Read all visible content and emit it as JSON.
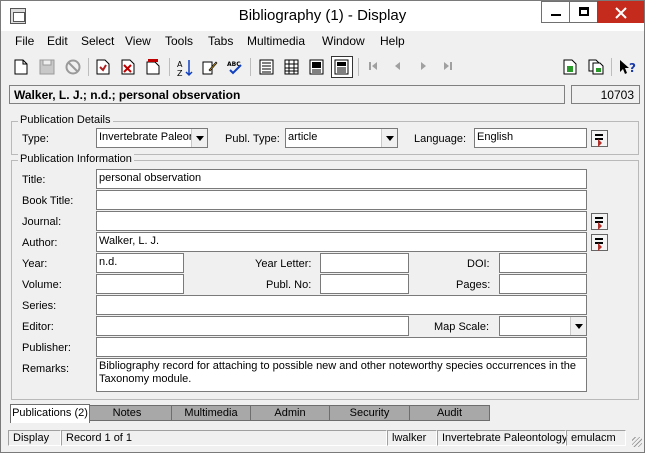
{
  "window": {
    "title": "Bibliography (1) - Display"
  },
  "menu": [
    "File",
    "Edit",
    "Select",
    "View",
    "Tools",
    "Tabs",
    "Multimedia",
    "Window",
    "Help"
  ],
  "toolbar": {
    "icons": [
      "new-record-icon",
      "save-icon",
      "cancel-icon",
      "open-icon",
      "delete-icon",
      "copy-icon",
      "sort-icon",
      "edit-icon",
      "spellcheck-icon",
      "page-view-icon",
      "list-view-icon",
      "report-view-icon",
      "form-view-icon",
      "first-record-icon",
      "prev-record-icon",
      "next-record-icon",
      "last-record-icon",
      "new-copy-icon",
      "duplicate-icon",
      "help-icon"
    ]
  },
  "header": {
    "summary": "Walker, L. J.; n.d.; personal observation",
    "record_id": "10703"
  },
  "publication_details": {
    "legend": "Publication Details",
    "type_label": "Type:",
    "type_value": "Invertebrate Paleon",
    "publ_type_label": "Publ. Type:",
    "publ_type_value": "article",
    "language_label": "Language:",
    "language_value": "English"
  },
  "publication_information": {
    "legend": "Publication Information",
    "title_label": "Title:",
    "title_value": "personal observation",
    "book_title_label": "Book Title:",
    "book_title_value": "",
    "journal_label": "Journal:",
    "journal_value": "",
    "author_label": "Author:",
    "author_value": "Walker, L. J.",
    "year_label": "Year:",
    "year_value": "n.d.",
    "year_letter_label": "Year Letter:",
    "year_letter_value": "",
    "doi_label": "DOI:",
    "doi_value": "",
    "volume_label": "Volume:",
    "volume_value": "",
    "publ_no_label": "Publ. No:",
    "publ_no_value": "",
    "pages_label": "Pages:",
    "pages_value": "",
    "series_label": "Series:",
    "series_value": "",
    "editor_label": "Editor:",
    "editor_value": "",
    "map_scale_label": "Map Scale:",
    "map_scale_value": "",
    "publisher_label": "Publisher:",
    "publisher_value": "",
    "remarks_label": "Remarks:",
    "remarks_value": "Bibliography record for attaching to possible new and other noteworthy species occurrences in the Taxonomy module."
  },
  "tabs": [
    {
      "label": "Publications (2)",
      "active": true
    },
    {
      "label": "Notes",
      "active": false
    },
    {
      "label": "Multimedia",
      "active": false
    },
    {
      "label": "Admin",
      "active": false
    },
    {
      "label": "Security",
      "active": false
    },
    {
      "label": "Audit",
      "active": false
    }
  ],
  "status": {
    "mode": "Display",
    "record": "Record 1 of 1",
    "user": "lwalker",
    "department": "Invertebrate Paleontology",
    "host": "emulacm"
  }
}
